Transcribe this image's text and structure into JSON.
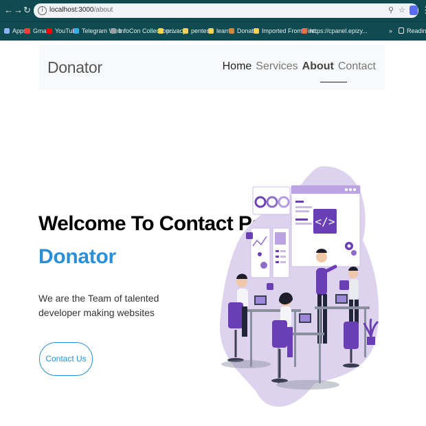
{
  "browser": {
    "url_host": "localhost:3000",
    "url_path": "/about",
    "bookmarks": [
      {
        "label": "Apps",
        "color": "#8ab4f8"
      },
      {
        "label": "Gmail",
        "color": "#ea4335"
      },
      {
        "label": "YouTube",
        "color": "#ff0000"
      },
      {
        "label": "Telegram Web",
        "color": "#37aee2"
      },
      {
        "label": "InfoCon Collection:...",
        "color": "#9aa0a6"
      },
      {
        "label": "privacy",
        "color": "#f6d25a"
      },
      {
        "label": "pentest",
        "color": "#f6d25a"
      },
      {
        "label": "learn",
        "color": "#f6d25a"
      },
      {
        "label": "Donate",
        "color": "#d08a3f"
      },
      {
        "label": "Imported From Fire...",
        "color": "#f6d25a"
      },
      {
        "label": "https://cpanel.epizy...",
        "color": "#e8704a"
      }
    ],
    "reading_list": "Reading list"
  },
  "navbar": {
    "brand": "Donator",
    "links": [
      "Home",
      "Services",
      "About",
      "Contact"
    ]
  },
  "hero": {
    "title": "Welcome To Contact Page",
    "subtitle": "Donator",
    "description": "We are the Team of talented developer making websites",
    "button": "Contact Us"
  },
  "colors": {
    "accent": "#2b8fd8",
    "chrome": "#0e4a4f",
    "purple": "#6a3fb5"
  }
}
